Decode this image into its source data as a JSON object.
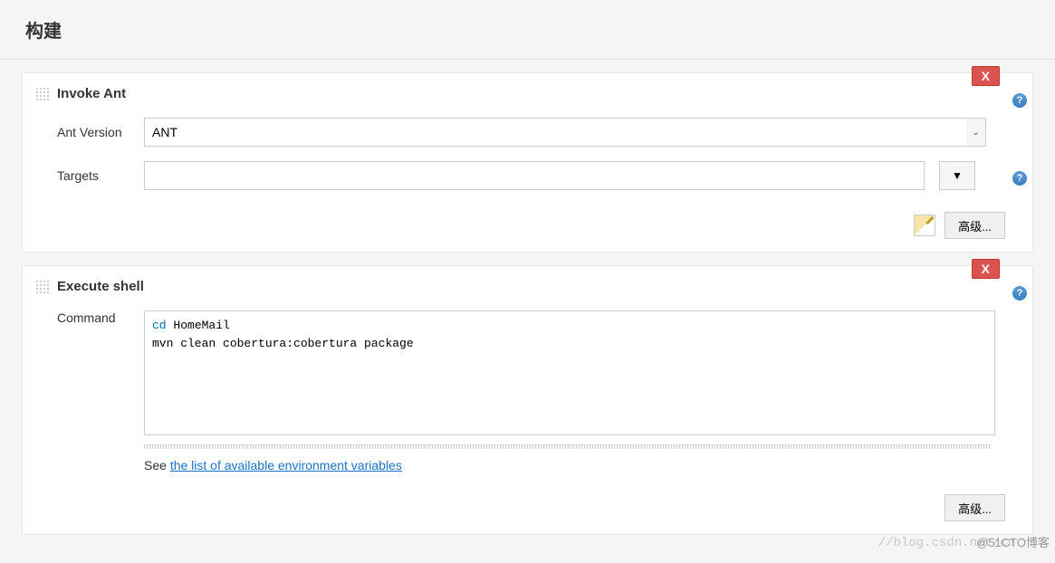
{
  "section": {
    "title": "构建"
  },
  "step1": {
    "delete": "X",
    "title": "Invoke Ant",
    "ant_version": {
      "label": "Ant Version",
      "value": "ANT"
    },
    "targets": {
      "label": "Targets",
      "value": "",
      "expand": "▼"
    },
    "advanced": "高级...",
    "help": "?"
  },
  "step2": {
    "delete": "X",
    "title": "Execute shell",
    "command": {
      "label": "Command",
      "value": "cd HomeMail\nmvn clean cobertura:cobertura package"
    },
    "see_prefix": "See ",
    "see_link": "the list of available environment variables",
    "advanced": "高级...",
    "help": "?"
  },
  "watermark": "//blog.csdn.net/ca",
  "watermark2": "@51CTO博客"
}
